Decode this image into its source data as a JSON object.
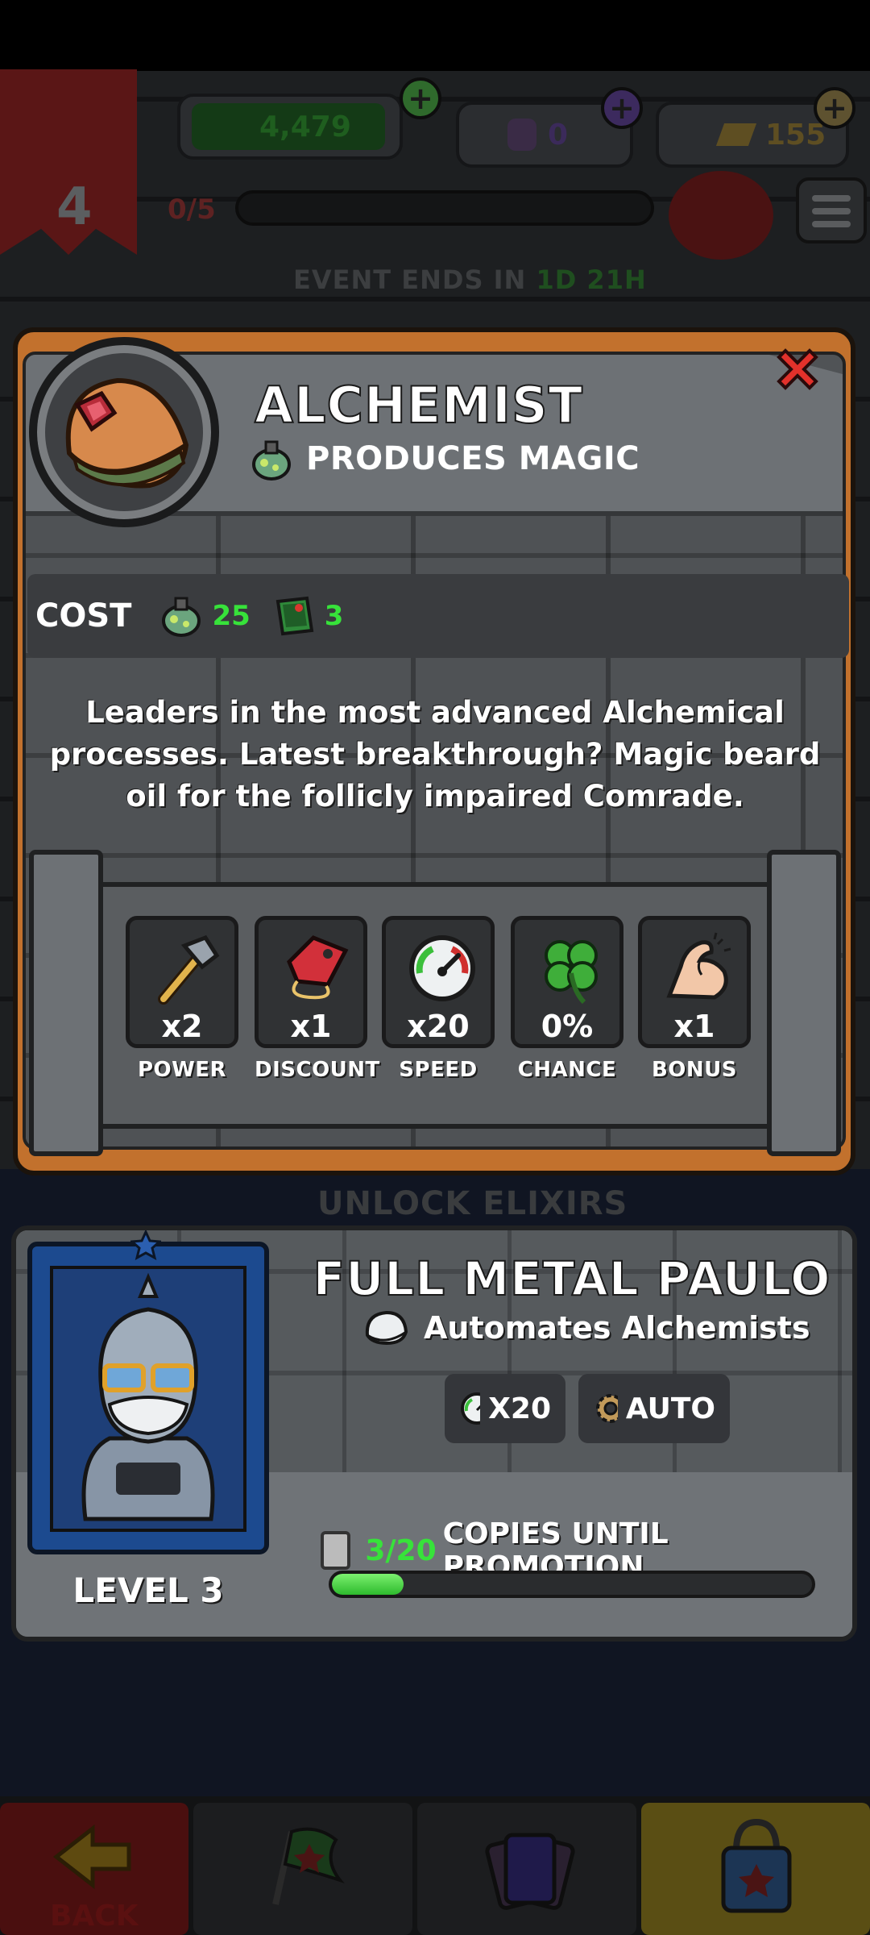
{
  "background": {
    "resources": {
      "cash": "4,479",
      "potions": "0",
      "gold": "155"
    },
    "player_level": "4",
    "progress": {
      "text": "0/5",
      "fraction": 0.0
    },
    "event_label": "EVENT ENDS IN",
    "event_time": "1D 21H",
    "unlock_label": "UNLOCK ELIXIRS",
    "back_label": "BACK"
  },
  "building": {
    "title": "ALCHEMIST",
    "subtitle": "PRODUCES MAGIC",
    "cost_label": "COST",
    "cost": [
      {
        "icon": "potion-icon",
        "value": "25"
      },
      {
        "icon": "cash-icon",
        "value": "3"
      }
    ],
    "description": "Leaders in the most advanced Alchemical processes. Latest breakthrough? Magic beard oil for the follicly impaired Comrade.",
    "stats": [
      {
        "icon": "hammer-icon",
        "value": "x2",
        "label": "POWER"
      },
      {
        "icon": "price-tag-icon",
        "value": "x1",
        "label": "DISCOUNT"
      },
      {
        "icon": "speedometer-icon",
        "value": "x20",
        "label": "SPEED"
      },
      {
        "icon": "clover-icon",
        "value": "0%",
        "label": "CHANCE"
      },
      {
        "icon": "bicep-icon",
        "value": "x1",
        "label": "BONUS"
      }
    ]
  },
  "manager": {
    "name": "FULL METAL PAULO",
    "subtitle": "Automates Alchemists",
    "level_label": "LEVEL 3",
    "chips": [
      {
        "icon": "speedometer-icon",
        "text": "X20"
      },
      {
        "icon": "gear-icon",
        "text": "AUTO"
      }
    ],
    "promotion": {
      "count": "3/20",
      "text": "COPIES UNTIL PROMOTION",
      "fraction": 0.15
    }
  },
  "colors": {
    "accent_green": "#37e23a",
    "rim_orange": "#c2712d",
    "close_red": "#e2312b",
    "portrait_blue": "#1c4a8f"
  }
}
